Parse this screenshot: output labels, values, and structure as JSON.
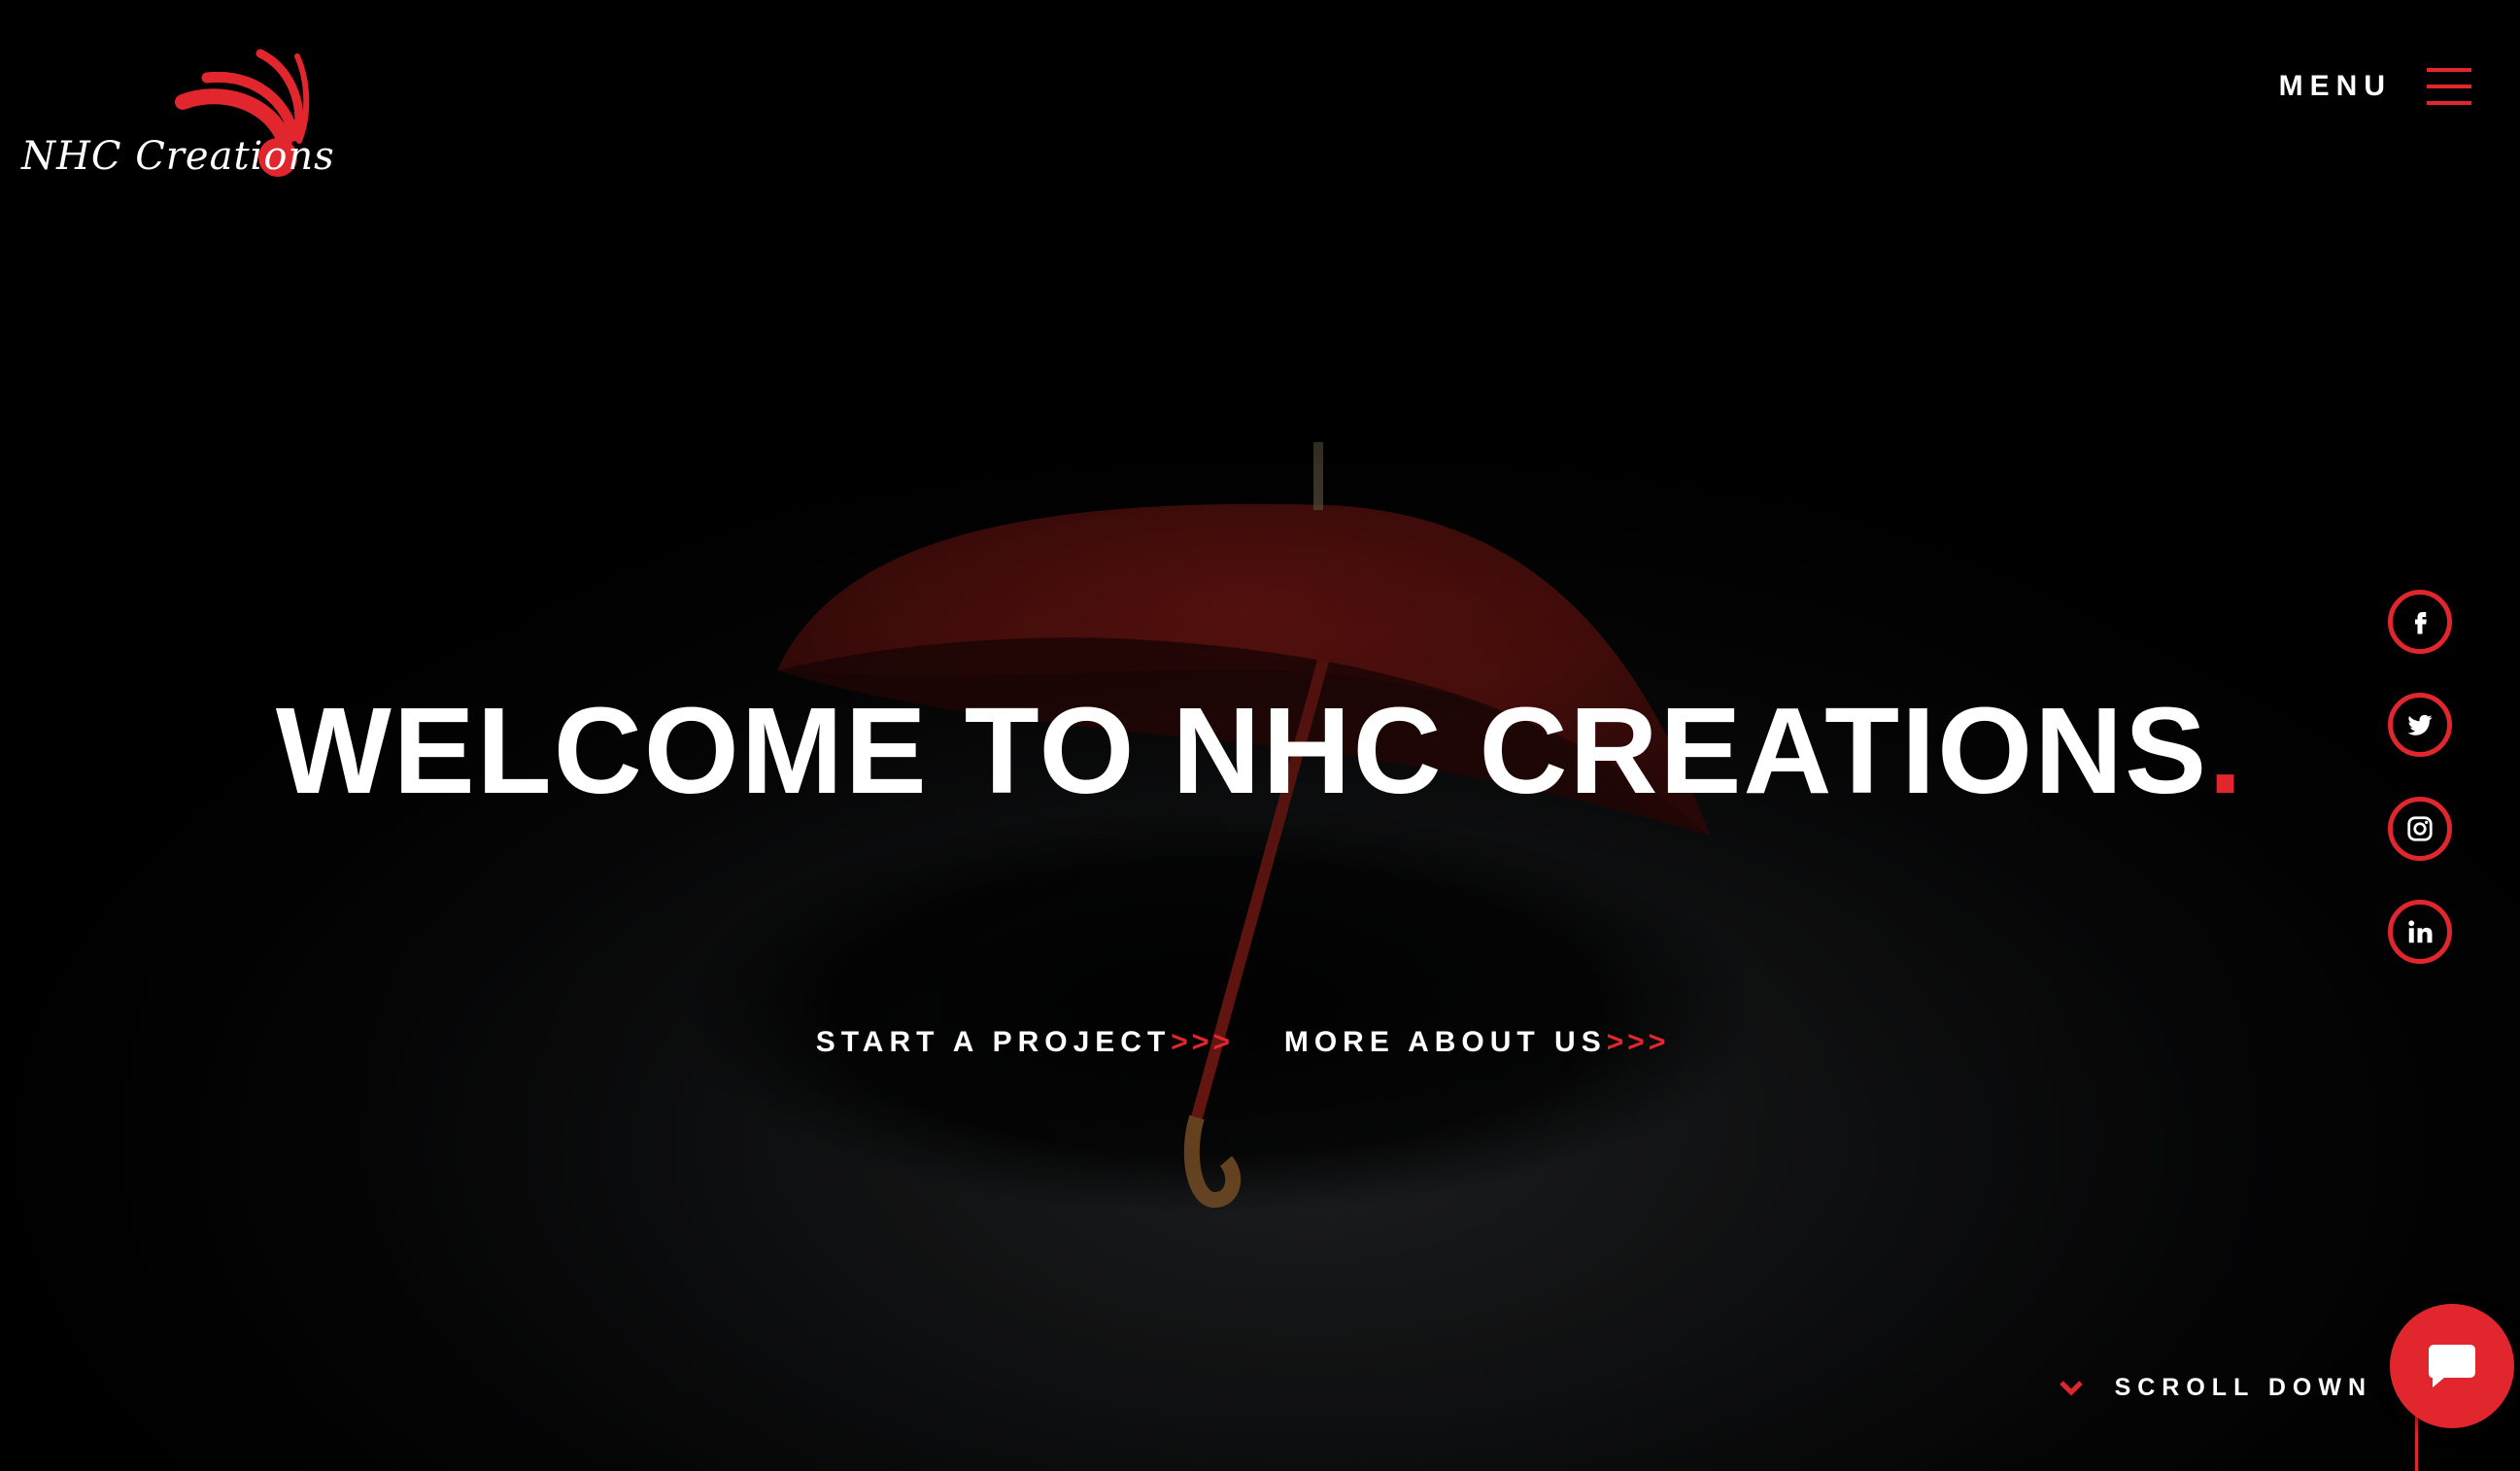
{
  "brand": {
    "logo_text": "NHC Creations",
    "accent_color": "#e2262e",
    "background_color": "#000000"
  },
  "header": {
    "menu_label": "MENU",
    "menu_icon": "hamburger-icon"
  },
  "hero": {
    "title": "WELCOME TO NHC CREATIONS",
    "title_dot": ".",
    "ctas": [
      {
        "label": "START A PROJECT",
        "arrows": ">>>"
      },
      {
        "label": "MORE ABOUT US",
        "arrows": ">>>"
      }
    ]
  },
  "social_links": [
    {
      "name": "facebook",
      "icon": "facebook-icon"
    },
    {
      "name": "twitter",
      "icon": "twitter-icon"
    },
    {
      "name": "instagram",
      "icon": "instagram-icon"
    },
    {
      "name": "linkedin",
      "icon": "linkedin-icon"
    }
  ],
  "footer": {
    "scroll_label": "SCROLL DOWN",
    "scroll_icon": "chevron-down-icon",
    "chat_icon": "chat-bubble-icon"
  }
}
